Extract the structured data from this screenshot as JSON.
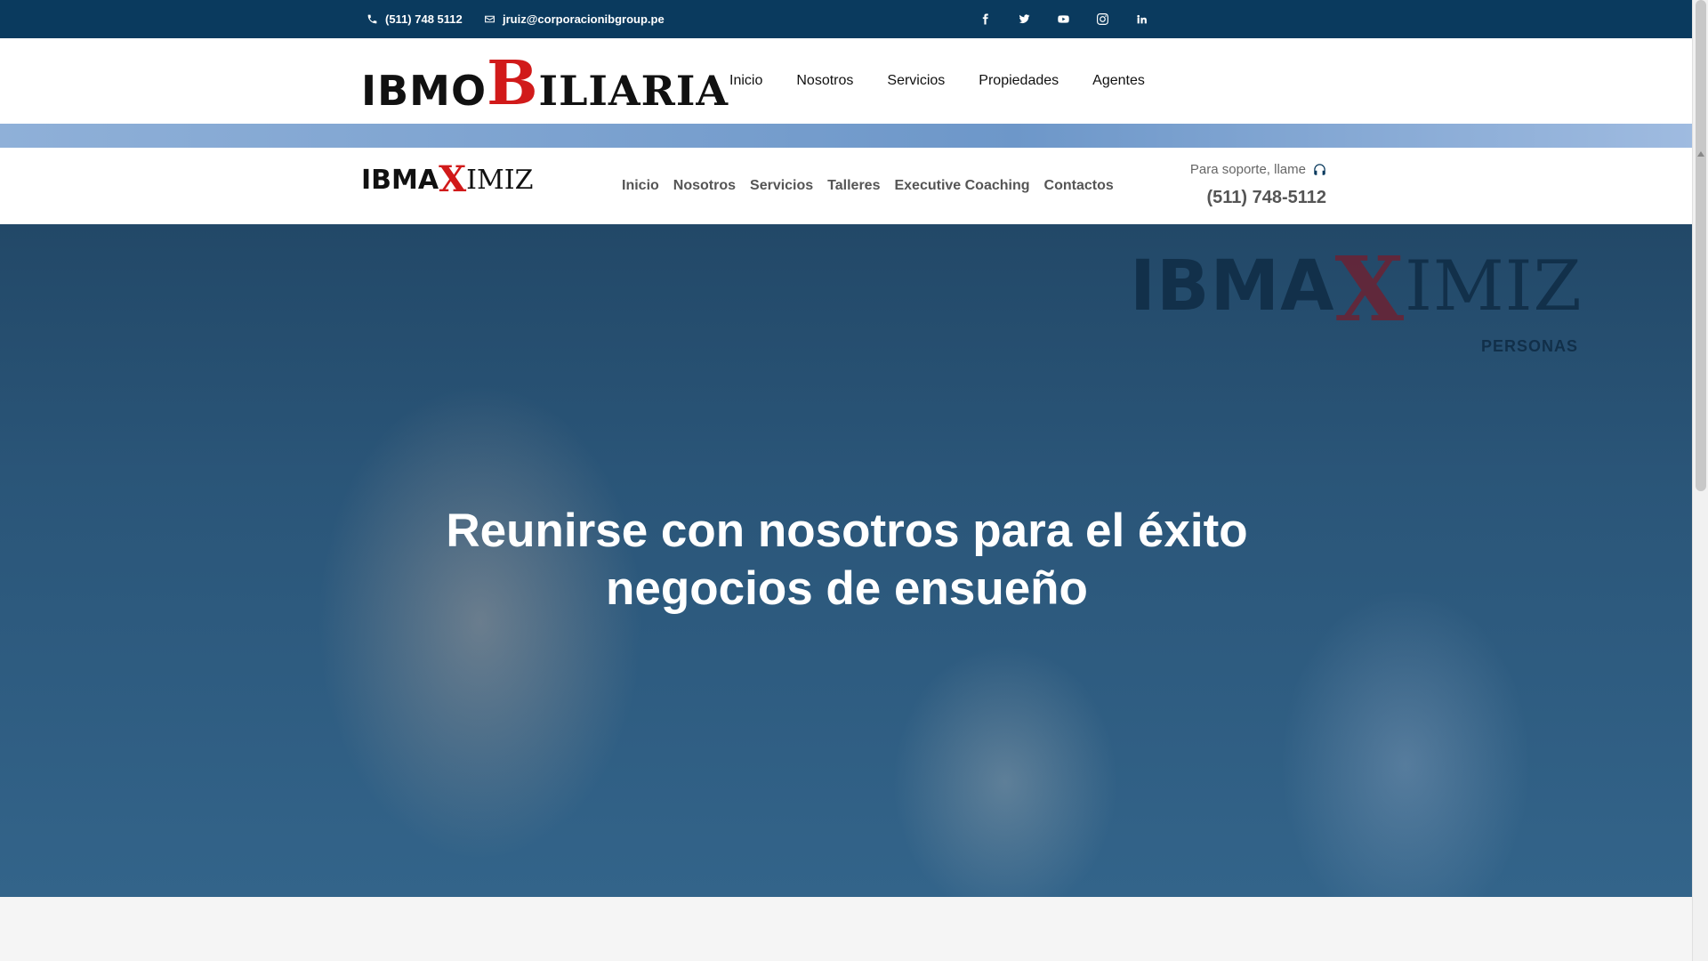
{
  "topbar": {
    "phone": "(511) 748 5112",
    "email": "jruiz@corporacionibgroup.pe",
    "social": [
      "facebook-icon",
      "twitter-icon",
      "youtube-icon",
      "instagram-icon",
      "linkedin-icon"
    ]
  },
  "header": {
    "logo": {
      "part1": "IBMO",
      "part2": "B",
      "part3": "ILIARIA"
    },
    "nav": [
      "Inicio",
      "Nosotros",
      "Servicios",
      "Propiedades",
      "Agentes"
    ]
  },
  "subheader": {
    "logo": {
      "part1": "IBMA",
      "part2": "X",
      "part3": "IMIZ"
    },
    "nav": [
      "Inicio",
      "Nosotros",
      "Servicios",
      "Talleres",
      "Executive Coaching",
      "Contactos"
    ],
    "support_label": "Para soporte, llame",
    "support_phone": "(511) 748-5112"
  },
  "hero": {
    "logo": {
      "part1": "IBMA",
      "part2": "X",
      "part3": "IMIZ"
    },
    "logo_sub": "PERSONAS",
    "title_line1": "Reunirse con nosotros para el éxito",
    "title_line2": "negocios de ensueño"
  },
  "colors": {
    "navy": "#0a3a5e",
    "brand_red": "#d11a1a"
  }
}
